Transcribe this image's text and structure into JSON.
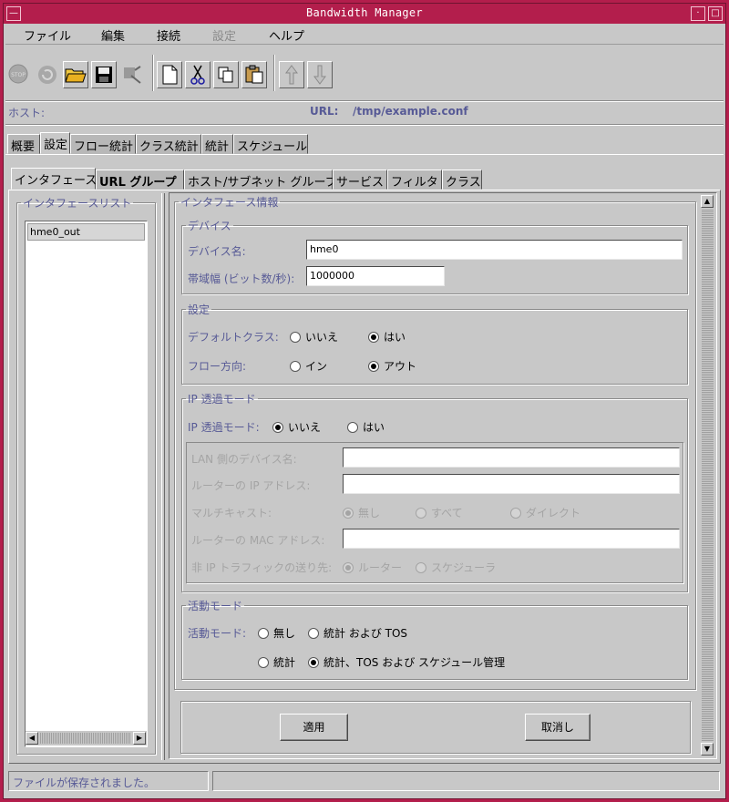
{
  "window": {
    "title": "Bandwidth Manager"
  },
  "menu": [
    {
      "label": "ファイル",
      "enabled": true
    },
    {
      "label": "編集",
      "enabled": true
    },
    {
      "label": "接続",
      "enabled": true
    },
    {
      "label": "設定",
      "enabled": false
    },
    {
      "label": "ヘルプ",
      "enabled": true
    }
  ],
  "toolbar": {
    "icons": [
      "stop-icon",
      "refresh-icon",
      "open-folder-icon",
      "save-icon",
      "save-as-icon",
      "new-document-icon",
      "cut-icon",
      "copy-icon",
      "paste-icon",
      "move-up-icon",
      "move-down-icon"
    ]
  },
  "info": {
    "host_label": "ホスト:",
    "host_value": "",
    "url_label": "URL:",
    "url_value": "/tmp/example.conf"
  },
  "main_tabs": [
    "概要",
    "設定",
    "フロー統計",
    "クラス統計",
    "統計",
    "スケジュール"
  ],
  "sub_tabs": [
    "インタフェース",
    "URL グループ",
    "ホスト/サブネット グループ",
    "サービス",
    "フィルタ",
    "クラス"
  ],
  "interface_list": {
    "title": "インタフェースリスト",
    "items": [
      "hme0_out"
    ]
  },
  "interface_info": {
    "title": "インタフェース情報",
    "device": {
      "title": "デバイス",
      "name_label": "デバイス名:",
      "name_value": "hme0",
      "bandwidth_label": "帯域幅 (ビット数/秒):",
      "bandwidth_value": "1000000"
    },
    "settings": {
      "title": "設定",
      "default_class_label": "デフォルトクラス:",
      "default_class_options": [
        "いいえ",
        "はい"
      ],
      "flow_direction_label": "フロー方向:",
      "flow_direction_options": [
        "イン",
        "アウト"
      ]
    },
    "ip_transparent": {
      "title": "IP 透過モード",
      "mode_label": "IP 透過モード:",
      "mode_options": [
        "いいえ",
        "はい"
      ],
      "lan_device_label": "LAN 側のデバイス名:",
      "lan_device_value": "",
      "router_ip_label": "ルーターの IP アドレス:",
      "router_ip_value": "",
      "multicast_label": "マルチキャスト:",
      "multicast_options": [
        "無し",
        "すべて",
        "ダイレクト"
      ],
      "router_mac_label": "ルーターの MAC アドレス:",
      "router_mac_value": "",
      "non_ip_label": "非 IP トラフィックの送り先:",
      "non_ip_options": [
        "ルーター",
        "スケジューラ"
      ]
    },
    "activity": {
      "title": "活動モード",
      "mode_label": "活動モード:",
      "options": [
        "無し",
        "統計 および TOS",
        "統計",
        "統計、TOS および スケジュール管理"
      ]
    }
  },
  "buttons": {
    "apply": "適用",
    "cancel": "取消し"
  },
  "status": {
    "message": "ファイルが保存されました。",
    "secondary": ""
  },
  "colors": {
    "titlebar": "#b31e4c",
    "label": "#575a96",
    "background": "#c8c8c8"
  }
}
